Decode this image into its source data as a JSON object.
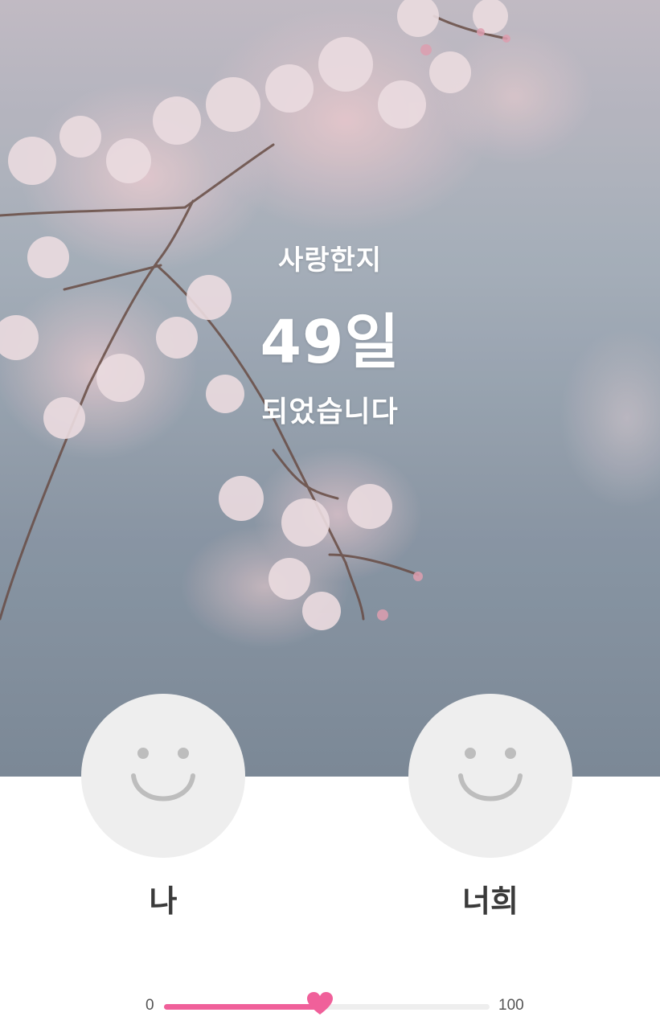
{
  "hero": {
    "line1": "사랑한지",
    "line2": "49일",
    "line3": "되었습니다",
    "background_icon": "cherry-blossom-photo"
  },
  "profiles": {
    "me": {
      "label": "나",
      "icon": "smiley-icon"
    },
    "partner": {
      "label": "너희",
      "icon": "smiley-icon"
    }
  },
  "slider": {
    "min_label": "0",
    "max_label": "100",
    "min": 0,
    "max": 100,
    "value": 48,
    "thumb_icon": "heart-icon"
  },
  "colors": {
    "accent": "#f0609a",
    "track": "#eeeeee",
    "avatar_bg": "#eeeeee",
    "hero_text": "#ffffff",
    "name_text": "#3a3a3a"
  }
}
